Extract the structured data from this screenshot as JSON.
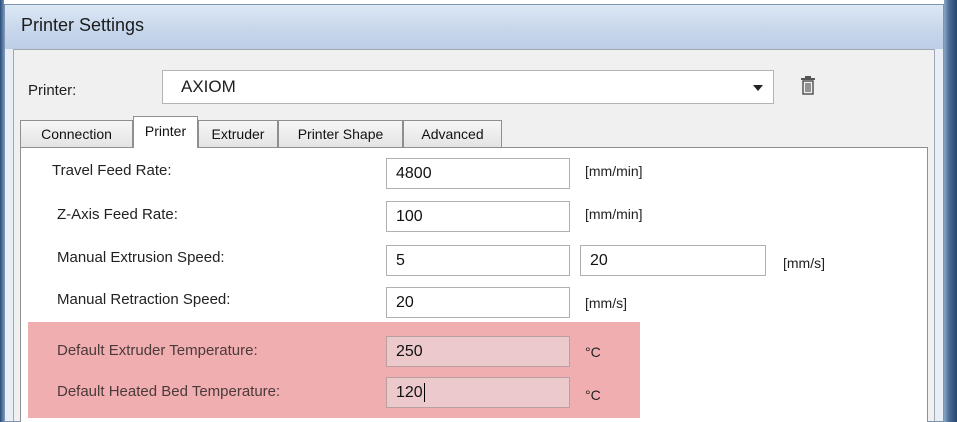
{
  "window": {
    "title": "Printer Settings"
  },
  "printer_row": {
    "label": "Printer:",
    "selected": "AXIOM"
  },
  "tabs": [
    {
      "label": "Connection"
    },
    {
      "label": "Printer",
      "active": true
    },
    {
      "label": "Extruder"
    },
    {
      "label": "Printer Shape"
    },
    {
      "label": "Advanced"
    }
  ],
  "fields": {
    "travel_feed_rate": {
      "label": "Travel Feed Rate:",
      "value": "4800",
      "unit": "[mm/min]"
    },
    "z_axis_feed_rate": {
      "label": "Z-Axis Feed Rate:",
      "value": "100",
      "unit": "[mm/min]"
    },
    "manual_extrusion_speed": {
      "label": "Manual Extrusion Speed:",
      "value": "5",
      "value2": "20",
      "unit": "[mm/s]"
    },
    "manual_retraction_speed": {
      "label": "Manual Retraction Speed:",
      "value": "20",
      "unit": "[mm/s]"
    },
    "default_extruder_temperature": {
      "label": "Default Extruder Temperature:",
      "value": "250",
      "unit": "°C"
    },
    "default_heated_bed_temperature": {
      "label": "Default Heated Bed Temperature:",
      "value": "120",
      "unit": "°C"
    }
  },
  "highlight_color": "#e56b71"
}
